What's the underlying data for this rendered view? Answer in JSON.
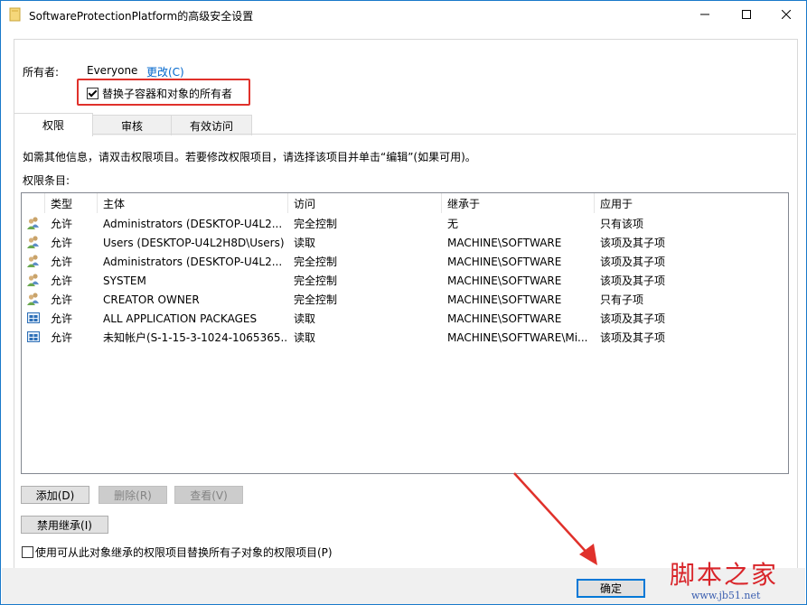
{
  "window": {
    "title": "SoftwareProtectionPlatform的高级安全设置",
    "controls": {
      "minimize": "—",
      "maximize": "□",
      "close": "✕"
    }
  },
  "owner": {
    "label": "所有者:",
    "value": "Everyone",
    "change_link": "更改(C)",
    "replace_checkbox_label": "替换子容器和对象的所有者",
    "replace_checked": true
  },
  "tabs": [
    {
      "label": "权限",
      "active": true
    },
    {
      "label": "审核",
      "active": false
    },
    {
      "label": "有效访问",
      "active": false
    }
  ],
  "info_text": "如需其他信息，请双击权限项目。若要修改权限项目，请选择该项目并单击“编辑”(如果可用)。",
  "entries_label": "权限条目:",
  "columns": [
    "类型",
    "主体",
    "访问",
    "继承于",
    "应用于"
  ],
  "rows": [
    {
      "icon": "users-icon",
      "type": "允许",
      "principal": "Administrators (DESKTOP-U4L2...",
      "access": "完全控制",
      "inherited": "无",
      "applies": "只有该项"
    },
    {
      "icon": "users-icon",
      "type": "允许",
      "principal": "Users (DESKTOP-U4L2H8D\\Users)",
      "access": "读取",
      "inherited": "MACHINE\\SOFTWARE",
      "applies": "该项及其子项"
    },
    {
      "icon": "users-icon",
      "type": "允许",
      "principal": "Administrators (DESKTOP-U4L2...",
      "access": "完全控制",
      "inherited": "MACHINE\\SOFTWARE",
      "applies": "该项及其子项"
    },
    {
      "icon": "users-icon",
      "type": "允许",
      "principal": "SYSTEM",
      "access": "完全控制",
      "inherited": "MACHINE\\SOFTWARE",
      "applies": "该项及其子项"
    },
    {
      "icon": "users-icon",
      "type": "允许",
      "principal": "CREATOR OWNER",
      "access": "完全控制",
      "inherited": "MACHINE\\SOFTWARE",
      "applies": "只有子项"
    },
    {
      "icon": "app-package-icon",
      "type": "允许",
      "principal": "ALL APPLICATION PACKAGES",
      "access": "读取",
      "inherited": "MACHINE\\SOFTWARE",
      "applies": "该项及其子项"
    },
    {
      "icon": "app-package-icon",
      "type": "允许",
      "principal": "未知帐户(S-1-15-3-1024-1065365...",
      "access": "读取",
      "inherited": "MACHINE\\SOFTWARE\\Mi...",
      "applies": "该项及其子项"
    }
  ],
  "buttons": {
    "add": "添加(D)",
    "remove": "删除(R)",
    "view": "查看(V)",
    "disable_inheritance": "禁用继承(I)",
    "ok": "确定"
  },
  "replace_child_checkbox": {
    "label": "使用可从此对象继承的权限项目替换所有子对象的权限项目(P)",
    "checked": false
  },
  "watermark": {
    "main": "脚本之家",
    "sub": "www.jb51.net"
  },
  "colors": {
    "accent": "#0078d7",
    "highlight": "#e0312b",
    "link": "#0066cc"
  }
}
